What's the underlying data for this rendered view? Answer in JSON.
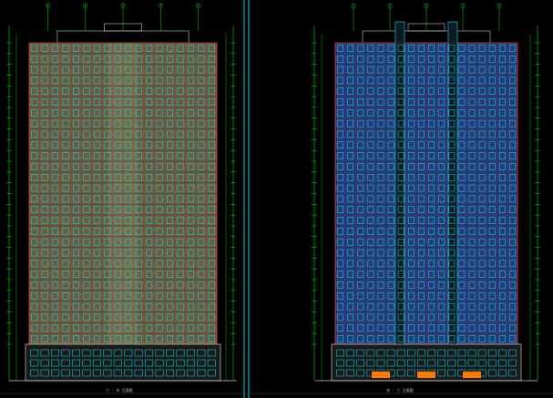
{
  "drawing": {
    "background": "#000000",
    "colors": {
      "outline": "#ff3030",
      "dimension": "#00e000",
      "window": "#00e8ff",
      "facade_tan": "#6e5a3e",
      "facade_blue": "#2a3a78",
      "frame": "#c8c8c8",
      "divider": "#00d8e0",
      "balcony": "#ff7a00"
    },
    "sheets": [
      {
        "caption": "① - ⑳ 立面图",
        "floors": 28,
        "bays": 18,
        "scheme": "tan"
      },
      {
        "caption": "⑳ - ① 立面图",
        "floors": 28,
        "bays": 18,
        "scheme": "blue"
      }
    ]
  }
}
